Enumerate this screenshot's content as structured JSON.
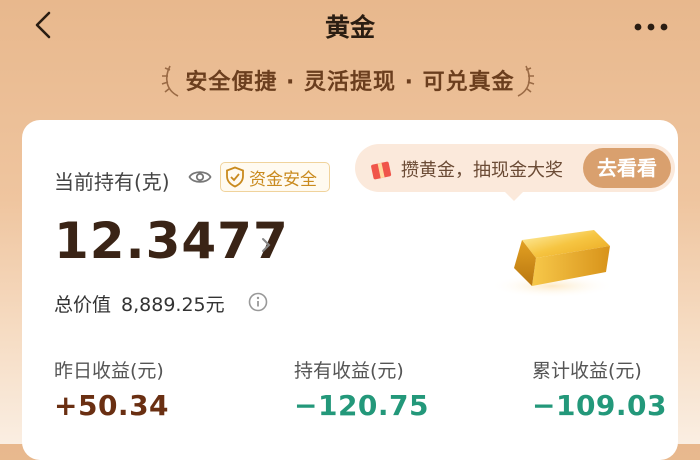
{
  "header": {
    "title": "黄金"
  },
  "slogan": "安全便捷 · 灵活提现 · 可兑真金",
  "holding": {
    "label": "当前持有(克)",
    "badge": "资金安全",
    "amount": "12.3477",
    "total_label": "总价值",
    "total_value": "8,889.25元"
  },
  "promo": {
    "text": "攒黄金，抽现金大奖",
    "button": "去看看"
  },
  "stats": [
    {
      "label": "昨日收益(元)",
      "value": "+50.34"
    },
    {
      "label": "持有收益(元)",
      "value": "−120.75"
    },
    {
      "label": "累计收益(元)",
      "value": "−109.03"
    }
  ],
  "icons": [
    "back-arrow-icon",
    "more-dots-icon",
    "eye-icon",
    "shield-check-icon",
    "gift-icon",
    "chevron-right-icon",
    "info-icon",
    "gold-bar-image",
    "laurel-left-icon",
    "laurel-right-icon"
  ],
  "colors": {
    "positive": "#6a2f12",
    "negative": "#23987a",
    "accent": "#d9a06e",
    "badge_text": "#c98a1e"
  }
}
